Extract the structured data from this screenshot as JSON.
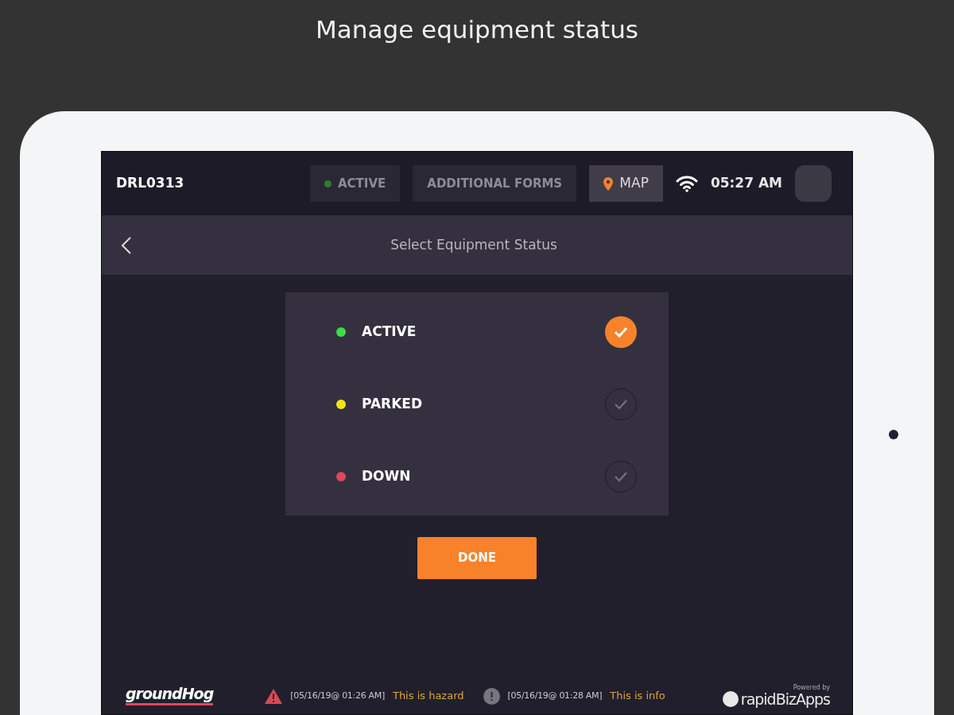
{
  "caption": "Manage equipment status",
  "header": {
    "equipment_id": "DRL0313",
    "status": {
      "label": "ACTIVE",
      "color": "#2e7d32"
    },
    "forms_button": "ADDITIONAL FORMS",
    "map_button": "MAP",
    "time": "05:27 AM"
  },
  "subheader": {
    "title": "Select Equipment Status"
  },
  "statuses": [
    {
      "label": "ACTIVE",
      "color": "#3ddc4a",
      "selected": true
    },
    {
      "label": "PARKED",
      "color": "#f2e21d",
      "selected": false
    },
    {
      "label": "DOWN",
      "color": "#e0485a",
      "selected": false
    }
  ],
  "done_button": "DONE",
  "footer": {
    "logo_left": "groundHog",
    "alerts": [
      {
        "kind": "hazard",
        "timestamp": "[05/16/19@ 01:26 AM]",
        "message": "This is hazard"
      },
      {
        "kind": "info",
        "timestamp": "[05/16/19@ 01:28 AM]",
        "message": "This is info"
      }
    ],
    "powered_by": "Powered by",
    "logo_right": "rapidBizApps"
  }
}
